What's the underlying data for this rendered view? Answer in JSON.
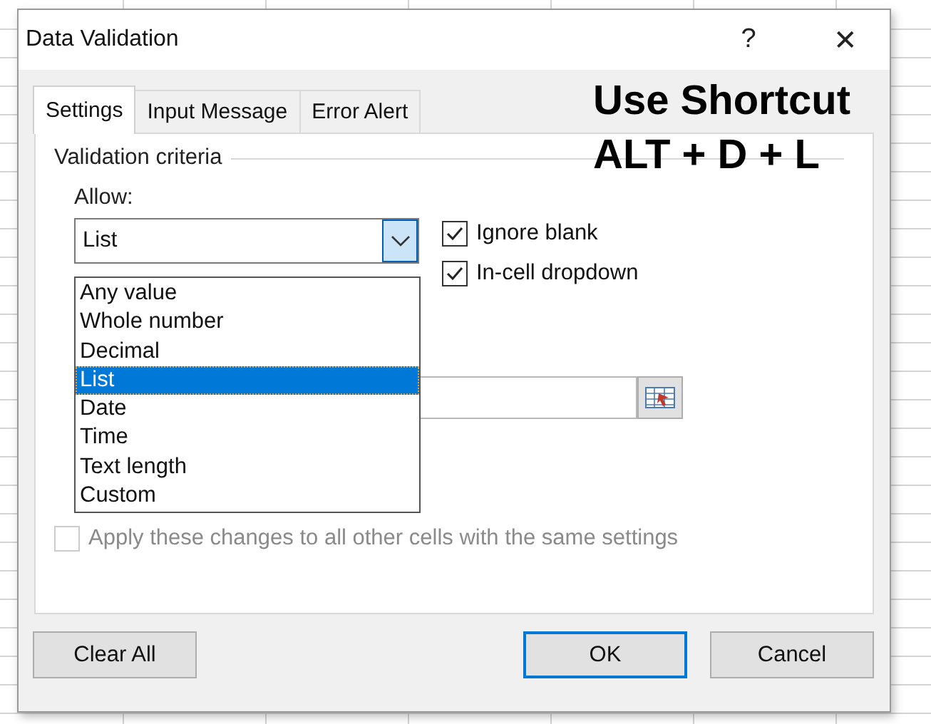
{
  "window": {
    "title": "Data Validation",
    "help": "?",
    "close": "✕"
  },
  "tabs": [
    {
      "label": "Settings",
      "selected": true
    },
    {
      "label": "Input Message",
      "selected": false
    },
    {
      "label": "Error Alert",
      "selected": false
    }
  ],
  "overlay": {
    "lines": [
      "Use Shortcut",
      "ALT + D + L"
    ]
  },
  "criteria": {
    "heading": "Validation criteria",
    "allow_label": "Allow:",
    "allow_value": "List",
    "expanded": true,
    "options": [
      {
        "label": "Any value",
        "selected": false
      },
      {
        "label": "Whole number",
        "selected": false
      },
      {
        "label": "Decimal",
        "selected": false
      },
      {
        "label": "List",
        "selected": true
      },
      {
        "label": "Date",
        "selected": false
      },
      {
        "label": "Time",
        "selected": false
      },
      {
        "label": "Text length",
        "selected": false
      },
      {
        "label": "Custom",
        "selected": false
      }
    ],
    "checkboxes": [
      {
        "label": "Ignore blank",
        "checked": true,
        "disabled": false
      },
      {
        "label": "In-cell dropdown",
        "checked": true,
        "disabled": false
      }
    ]
  },
  "apply_all": {
    "label": "Apply these changes to all other cells with the same settings",
    "checked": false,
    "disabled": true
  },
  "buttons": [
    {
      "label": "Clear All",
      "default": false
    },
    {
      "label": "OK",
      "default": true
    },
    {
      "label": "Cancel",
      "default": false
    }
  ]
}
